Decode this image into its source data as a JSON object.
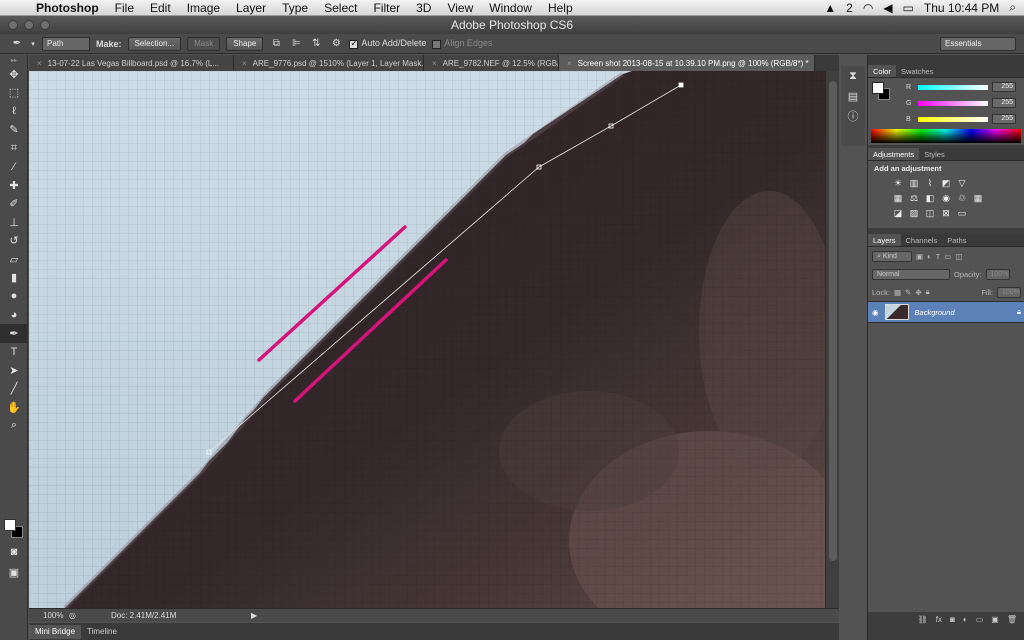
{
  "menubar": {
    "app_name": "Photoshop",
    "items": [
      "File",
      "Edit",
      "Image",
      "Layer",
      "Type",
      "Select",
      "Filter",
      "3D",
      "View",
      "Window",
      "Help"
    ],
    "status": {
      "notifications": "2",
      "clock": "Thu 10:44 PM"
    }
  },
  "window": {
    "title": "Adobe Photoshop CS6"
  },
  "options": {
    "mode": "Path",
    "make_label": "Make:",
    "selection_btn": "Selection...",
    "mask_btn": "Mask",
    "shape_btn": "Shape",
    "auto_add_delete": "Auto Add/Delete",
    "align_edges": "Align Edges",
    "workspace": "Essentials"
  },
  "tabs": [
    {
      "label": "13-07-22 Las Vegas Billboard.psd @ 16.7% (L...",
      "active": false
    },
    {
      "label": "ARE_9776.psd @ 1510% (Layer 1, Layer Mask...",
      "active": false
    },
    {
      "label": "ARE_9782.NEF @ 12.5% (RGB/...",
      "active": false
    },
    {
      "label": "Screen shot 2013-08-15 at 10.39.10 PM.png @ 100% (RGB/8*) *",
      "active": true
    }
  ],
  "status": {
    "zoom": "100%",
    "doc": "Doc: 2.41M/2.41M"
  },
  "bottom_tabs": {
    "mini_bridge": "Mini Bridge",
    "timeline": "Timeline"
  },
  "color_panel": {
    "tab_color": "Color",
    "tab_swatches": "Swatches",
    "r_label": "R",
    "g_label": "G",
    "b_label": "B",
    "r": "255",
    "g": "255",
    "b": "255"
  },
  "adjustments_panel": {
    "tab_adjustments": "Adjustments",
    "tab_styles": "Styles",
    "add_label": "Add an adjustment"
  },
  "layers_panel": {
    "tab_layers": "Layers",
    "tab_channels": "Channels",
    "tab_paths": "Paths",
    "kind": "Kind",
    "blend_mode": "Normal",
    "opacity_label": "Opacity:",
    "opacity": "100%",
    "lock_label": "Lock:",
    "fill_label": "Fill:",
    "fill": "100%",
    "layer_name": "Background"
  },
  "colors": {
    "sky": "#c5d6e1",
    "subject_dark": "#2f2527",
    "annotation_magenta": "#d4147a",
    "path_line": "#e8e8e8"
  }
}
